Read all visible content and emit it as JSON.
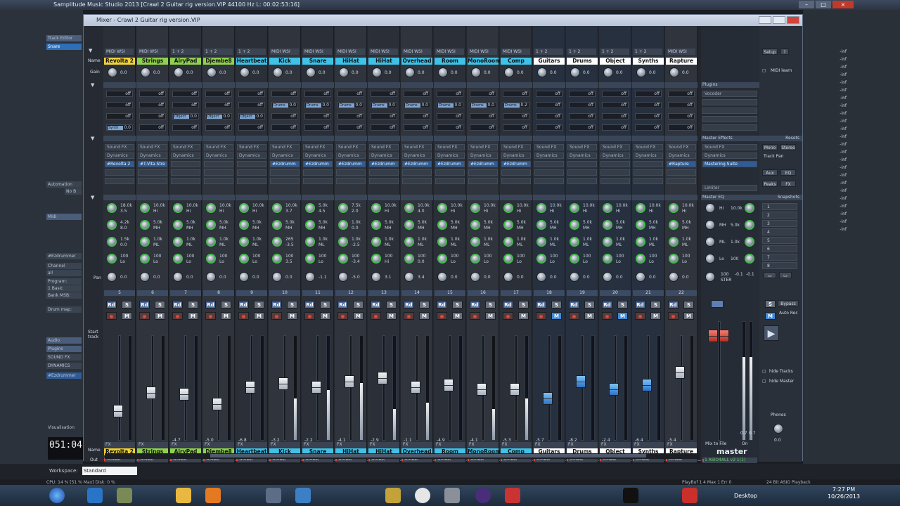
{
  "app": {
    "title": "Samplitude Music Studio 2013   [Crawl 2 Guitar rig version.VIP   44100 Hz L: 00:02:53:16]"
  },
  "mixer": {
    "title": "Mixer - Crawl 2 Guitar rig version.VIP",
    "row_labels": {
      "name": "Name",
      "gain": "Gain",
      "aux": "Aux",
      "inserts": "Inserts",
      "eq": "EQ",
      "pan": "Pan",
      "out": "Out",
      "start_track": "Start track"
    },
    "channels": [
      {
        "num": "5",
        "midi": "MIDI WSI",
        "name": "Revolta 2",
        "name_color": "#f0d23a",
        "gain": "0.0",
        "aux_tag": "Synth",
        "aux_tag_val": "0.0",
        "insert1": "Sound FX",
        "insert2": "Dynamics",
        "insert3": "#Revolta 2",
        "eq": [
          "18.0k",
          "3.5",
          "4.2k",
          "8.0",
          "1.5k",
          "0.0",
          "100",
          "Lo"
        ],
        "pan": "0.0",
        "fader": 60,
        "meter": 0,
        "peak": "",
        "fx": "FX",
        "out": "StMast"
      },
      {
        "num": "6",
        "midi": "MIDI WSI",
        "name": "Strings",
        "name_color": "#8fd14f",
        "gain": "0.0",
        "insert1": "Sound FX",
        "insert2": "Dynamics",
        "insert3": "#T-Vita Stre",
        "eq": [
          "10.0k",
          "Hi",
          "5.0k",
          "MH",
          "1.0k",
          "ML",
          "100",
          "Lo"
        ],
        "pan": "0.0",
        "fader": 40,
        "meter": 0,
        "peak": "",
        "fx": "FX",
        "out": "StMast"
      },
      {
        "num": "7",
        "midi": "1 + 2",
        "name": "AiryPad",
        "name_color": "#8fd14f",
        "gain": "0.0",
        "aux_tag": "Object",
        "aux_tag_val": "0.0",
        "insert1": "Sound FX",
        "insert2": "Dynamics",
        "insert3": "",
        "eq": [
          "10.0k",
          "Hi",
          "5.0k",
          "MH",
          "1.0k",
          "ML",
          "100",
          "Lo"
        ],
        "pan": "0.0",
        "fader": 42,
        "meter": 0,
        "peak": "-4.7",
        "fx": "FX",
        "out": "StMast"
      },
      {
        "num": "8",
        "midi": "1 + 2",
        "name": "Djembe8",
        "name_color": "#8fd14f",
        "gain": "0.0",
        "aux_tag": "Object",
        "aux_tag_val": "0.0",
        "insert1": "Sound FX",
        "insert2": "Dynamics",
        "insert3": "",
        "eq": [
          "10.0k",
          "Hi",
          "5.0k",
          "MH",
          "1.0k",
          "ML",
          "100",
          "Lo"
        ],
        "pan": "0.0",
        "fader": 52,
        "meter": 0,
        "peak": "-5.0",
        "fx": "FX",
        "out": "StMast"
      },
      {
        "num": "9",
        "midi": "1 + 2",
        "name": "Heartbeat",
        "name_color": "#3fc2e8",
        "gain": "0.0",
        "aux_tag": "Object",
        "aux_tag_val": "0.0",
        "insert1": "Sound FX",
        "insert2": "Dynamics",
        "insert3": "",
        "eq": [
          "10.0k",
          "Hi",
          "5.0k",
          "MH",
          "1.0k",
          "ML",
          "100",
          "Lo"
        ],
        "pan": "0.0",
        "fader": 34,
        "meter": 0,
        "peak": "-6.8",
        "fx": "FX",
        "out": "StMast"
      },
      {
        "num": "10",
        "midi": "MIDI WSI",
        "name": "Kick",
        "name_color": "#3fc2e8",
        "gain": "0.0",
        "aux_tag": "Drums",
        "aux_tag_val": "0.0",
        "insert1": "Sound FX",
        "insert2": "Dynamics",
        "insert3": "#Ezdrumm",
        "eq": [
          "10.0k",
          "3.7",
          "5.0k",
          "MH",
          "265",
          "-3.5",
          "100",
          "3.5"
        ],
        "pan": "0.0",
        "fader": 30,
        "meter": 40,
        "peak": "-3.2",
        "fx": "FX",
        "out": "StMast"
      },
      {
        "num": "11",
        "midi": "MIDI WSI",
        "name": "Snare",
        "name_color": "#3fc2e8",
        "gain": "0.0",
        "aux_tag": "Drums",
        "aux_tag_val": "0.0",
        "insert1": "Sound FX",
        "insert2": "Dynamics",
        "insert3": "#Ezdrumm",
        "eq": [
          "5.0k",
          "4.5",
          "5.0k",
          "MH",
          "1.0k",
          "ML",
          "100",
          "Lo"
        ],
        "pan": "-1.1",
        "fader": 34,
        "meter": 48,
        "peak": "-2.2",
        "fx": "FX",
        "out": "StMast"
      },
      {
        "num": "12",
        "midi": "MIDI WSI",
        "name": "HiHat",
        "name_color": "#3fc2e8",
        "gain": "0.0",
        "aux_tag": "Drums",
        "aux_tag_val": "0.0",
        "insert1": "Sound FX",
        "insert2": "Dynamics",
        "insert3": "#Ezdrumm",
        "eq": [
          "7.5k",
          "2.0",
          "1.0k",
          "0.0",
          "1.0k",
          "-2.5",
          "100",
          "-3.4"
        ],
        "pan": "-5.0",
        "fader": 28,
        "meter": 55,
        "peak": "-4.1",
        "fx": "FX",
        "out": "StMast"
      },
      {
        "num": "13",
        "midi": "MIDI WSI",
        "name": "HiHat",
        "name_color": "#3fc2e8",
        "gain": "0.0",
        "aux_tag": "Drums",
        "aux_tag_val": "0.0",
        "insert1": "Sound FX",
        "insert2": "Dynamics",
        "insert3": "#Ezdrumm",
        "eq": [
          "10.0k",
          "Hi",
          "5.0k",
          "MH",
          "1.0k",
          "ML",
          "100",
          "Hi"
        ],
        "pan": "3.1",
        "fader": 24,
        "meter": 30,
        "peak": "-2.9",
        "fx": "FX",
        "out": "StMast"
      },
      {
        "num": "14",
        "midi": "MIDI WSI",
        "name": "Overhead",
        "name_color": "#3fc2e8",
        "gain": "0.0",
        "aux_tag": "Drums",
        "aux_tag_val": "0.0",
        "insert1": "Sound FX",
        "insert2": "Dynamics",
        "insert3": "#Ezdrumm",
        "eq": [
          "10.0k",
          "4.0",
          "5.0k",
          "MH",
          "1.0k",
          "ML",
          "100",
          "0.0"
        ],
        "pan": "3.4",
        "fader": 34,
        "meter": 36,
        "peak": "-1.1",
        "fx": "FX",
        "out": "StMast"
      },
      {
        "num": "15",
        "midi": "MIDI WSI",
        "name": "Room",
        "name_color": "#3fc2e8",
        "gain": "0.0",
        "aux_tag": "Drums",
        "aux_tag_val": "0.0",
        "insert1": "Sound FX",
        "insert2": "Dynamics",
        "insert3": "#Ezdrumm",
        "eq": [
          "10.0k",
          "Hi",
          "5.0k",
          "MH",
          "1.0k",
          "ML",
          "100",
          "Lo"
        ],
        "pan": "0.0",
        "fader": 32,
        "meter": 0,
        "peak": "-4.9",
        "fx": "FX",
        "out": "StMast"
      },
      {
        "num": "16",
        "midi": "MIDI WSI",
        "name": "MonoRoom",
        "name_color": "#3fc2e8",
        "gain": "0.0",
        "aux_tag": "Drums",
        "aux_tag_val": "0.0",
        "insert1": "Sound FX",
        "insert2": "Dynamics",
        "insert3": "#Ezdrumm",
        "eq": [
          "10.0k",
          "Hi",
          "5.0k",
          "MH",
          "1.0k",
          "ML",
          "100",
          "Lo"
        ],
        "pan": "0.0",
        "fader": 36,
        "meter": 30,
        "peak": "-4.1",
        "fx": "FX",
        "out": "StMast"
      },
      {
        "num": "17",
        "midi": "MIDI WSI",
        "name": "Comp",
        "name_color": "#3fc2e8",
        "gain": "0.0",
        "aux_tag": "Drums",
        "aux_tag_val": "-0.2",
        "insert1": "Sound FX",
        "insert2": "Dynamics",
        "insert3": "#Ezdrumm",
        "eq": [
          "10.0k",
          "Hi",
          "5.0k",
          "MH",
          "1.0k",
          "ML",
          "100",
          "Lo"
        ],
        "pan": "0.0",
        "fader": 36,
        "meter": 40,
        "peak": "-5.3",
        "fx": "FX",
        "out": "StMast"
      },
      {
        "num": "18",
        "midi": "1 + 2",
        "name": "Guitars",
        "name_color": "#ffffff",
        "gain": "0.0",
        "insert1": "Sound FX",
        "insert2": "Dynamics",
        "insert3": "",
        "eq": [
          "10.0k",
          "Hi",
          "5.0k",
          "MH",
          "1.0k",
          "ML",
          "100",
          "Lo"
        ],
        "pan": "0.0",
        "fader": 46,
        "meter": 0,
        "peak": "-5.7",
        "fx": "FX",
        "out": "StMast",
        "bus": true
      },
      {
        "num": "19",
        "midi": "1 + 2",
        "name": "Drums",
        "name_color": "#ffffff",
        "gain": "0.0",
        "insert1": "Sound FX",
        "insert2": "Dynamics",
        "insert3": "",
        "eq": [
          "10.0k",
          "Hi",
          "5.0k",
          "MH",
          "1.0k",
          "ML",
          "100",
          "Lo"
        ],
        "pan": "0.0",
        "fader": 28,
        "meter": 0,
        "peak": "-8.2",
        "fx": "FX",
        "out": "StMast",
        "bus": true
      },
      {
        "num": "20",
        "midi": "1 + 2",
        "name": "Object",
        "name_color": "#ffffff",
        "gain": "0.0",
        "insert1": "Sound FX",
        "insert2": "Dynamics",
        "insert3": "",
        "eq": [
          "10.0k",
          "Hi",
          "5.0k",
          "MH",
          "1.0k",
          "ML",
          "100",
          "Lo"
        ],
        "pan": "0.0",
        "fader": 36,
        "meter": 0,
        "peak": "-2.4",
        "fx": "FX",
        "out": "StMast",
        "bus": true
      },
      {
        "num": "21",
        "midi": "1 + 2",
        "name": "Synths",
        "name_color": "#ffffff",
        "gain": "0.0",
        "insert1": "Sound FX",
        "insert2": "Dynamics",
        "insert3": "",
        "eq": [
          "10.0k",
          "Hi",
          "5.0k",
          "MH",
          "1.0k",
          "ML",
          "100",
          "Lo"
        ],
        "pan": "0.0",
        "fader": 32,
        "meter": 0,
        "peak": "-6.4",
        "fx": "FX",
        "out": "StMast",
        "bus": true
      },
      {
        "num": "22",
        "midi": "MIDI WSI",
        "name": "Rapture",
        "name_color": "#ffffff",
        "gain": "0.0",
        "insert1": "Sound FX",
        "insert2": "Dynamics",
        "insert3": "#Rapture",
        "eq": [
          "10.0k",
          "Hi",
          "5.0k",
          "MH",
          "1.0k",
          "ML",
          "100",
          "Lo"
        ],
        "pan": "0.0",
        "fader": 18,
        "meter": 0,
        "peak": "-5.4",
        "fx": "FX",
        "out": "StMast"
      }
    ],
    "aux_off": "off",
    "master": {
      "label": "master",
      "plugins_label": "Plugins",
      "plugin_item": "Vocoder",
      "effects_label": "Master Effects",
      "effects_slot1": "Sound FX",
      "effects_slot2": "Dynamics",
      "effects_slot3": "Mastering Suite",
      "limiter": "Limiter",
      "eq_label": "Master EQ",
      "eq": [
        "Hi",
        "10.0k",
        "MH",
        "5.0k",
        "ML",
        "1.0k",
        "Lo",
        "100"
      ],
      "stereo": "100",
      "ster": "STER",
      "meter_vals": [
        "-0.1",
        "-0.1"
      ],
      "peak_vals": [
        "0.7",
        "0.7"
      ],
      "mix_to_file": "Mix to File",
      "on": "On",
      "out": "1 ASIO4ALL v2 1(1)",
      "bypass": "Bypass",
      "auto_rec": "Auto Rec"
    },
    "right": {
      "setup": "Setup",
      "help": "?",
      "midi_learn": "MIDI learn",
      "resets": "Resets",
      "mono": "Mono",
      "stereo": "Stereo",
      "track_pan": "Track Pan",
      "aux": "Aux",
      "eq_btn": "EQ",
      "peaks": "Peaks",
      "fx_btn": "FX",
      "snapshots": "Snapshots",
      "snapshot_items": [
        "1",
        "2",
        "3",
        "4",
        "5",
        "6",
        "7",
        "8"
      ],
      "hide_tracks": "hide Tracks",
      "hide_master": "hide Master",
      "phones": "Phones",
      "phones_val": "0.0"
    }
  },
  "left_panel": {
    "track_editor": "Track Editor",
    "tab": "Snare",
    "midi": "Midi",
    "automation": "Automation",
    "no_b": "No B",
    "channel": "Channel",
    "channel_val": "all",
    "program": "Program:",
    "program_val": "1 Basic",
    "bank_msb": "Bank MSB:",
    "drum_map": "Drum map:",
    "audio": "Audio",
    "plugins": "Plugins",
    "sound_fx": "SOUND FX",
    "dynamics": "DYNAMICS",
    "ezdrummer": "#Ezdrummer",
    "visualisation": "Visualisation"
  },
  "right_values": [
    "-inf",
    "-inf",
    "-inf",
    "-inf",
    "-inf",
    "-inf",
    "-inf",
    "-inf",
    "-inf",
    "-inf",
    "-inf",
    "-inf",
    "-inf",
    "-inf",
    "-inf",
    "-inf",
    "-inf",
    "-inf",
    "-inf",
    "-inf",
    "-inf",
    "-inf",
    "-inf",
    "-inf"
  ],
  "timecode": "051:04",
  "workspace": {
    "label": "Workspace:",
    "value": "Standard"
  },
  "status": {
    "cpu": "CPU: 14 %  [51 % Max]   Disk: 0 %",
    "playbar": "PlayBuf 1  4  Max 1  Err 0",
    "asio": "24 Bit ASIO Playback"
  },
  "taskbar": {
    "desktop": "Desktop",
    "time": "7:27 PM",
    "date": "10/26/2013"
  },
  "colors": {
    "accent": "#3f89d6",
    "record": "#e0463c",
    "yellow_name": "#f0d23a",
    "green_name": "#8fd14f",
    "cyan_name": "#3fc2e8"
  }
}
